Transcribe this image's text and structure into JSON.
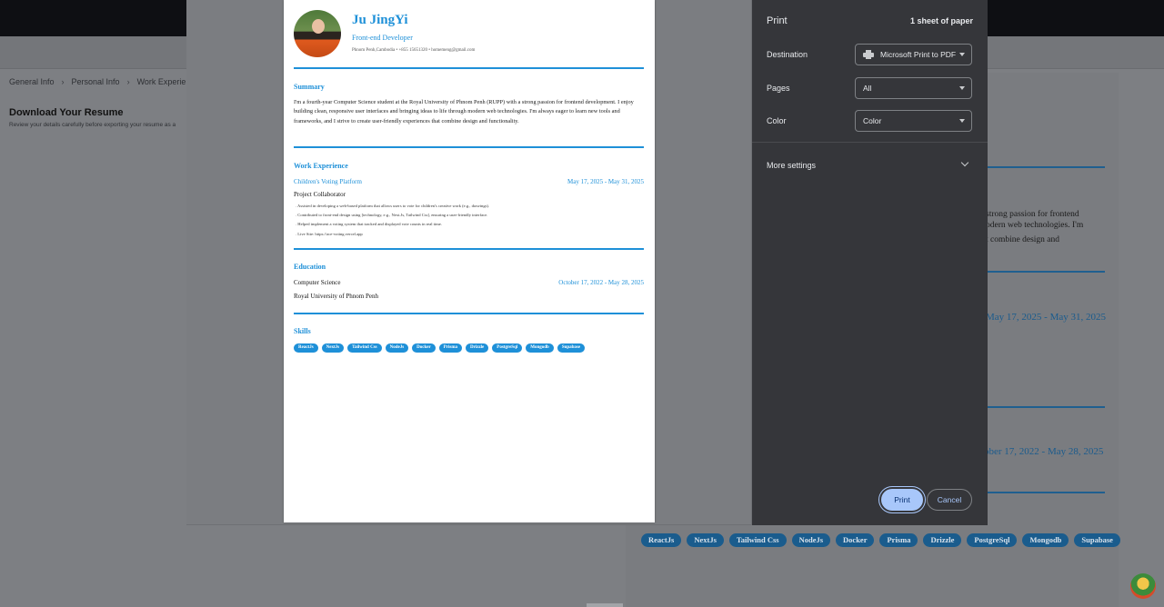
{
  "background_app": {
    "breadcrumbs": [
      "General Info",
      "Personal Info",
      "Work Experience"
    ],
    "page_title": "Download Your Resume",
    "page_subtitle": "Review your details carefully before exporting your resume as a",
    "preview_fragments": {
      "summary_line1": "strong passion for frontend",
      "summary_line2": "odern web technologies. I'm",
      "summary_line3": "t combine design and",
      "work_date": "May 17, 2025 - May 31, 2025",
      "edu_date": "ober 17, 2022 - May 28, 2025"
    },
    "skills": [
      "ReactJs",
      "NextJs",
      "Tailwind Css",
      "NodeJs",
      "Docker",
      "Prisma",
      "Drizzle",
      "PostgreSql",
      "Mongodb",
      "Supabase"
    ]
  },
  "resume": {
    "name": "Ju JingYi",
    "role": "Front-end Developer",
    "contact": "Phnom Penh,Cambodia • +855 15651320 • homemeng@gmail.com",
    "summary_heading": "Summary",
    "summary_text": "I'm a fourth-year Computer Science student at the Royal University of Phnom Penh (RUPP) with a strong passion for frontend development. I enjoy building clean, responsive user interfaces and bringing ideas to life through modern web technologies. I'm always eager to learn new tools and frameworks, and I strive to create user-friendly experiences that combine design and functionality.",
    "work_heading": "Work Experience",
    "work": {
      "title": "Children's Voting Platform",
      "dates": "May 17, 2025 - May 31, 2025",
      "position": "Project Collaborator",
      "bullets": [
        ". Assisted in developing a web-based platform that allows users to vote for children's creative work (e.g., drawings).",
        ". Contributed to front-end design using [technology, e.g., Next.Js, Tailwind Css], ensuring a user-friendly interface.",
        ". Helped implement a voting system that tracked and displayed vote counts in real time.",
        ". Live Site: https://ace-voting.vercel.app"
      ]
    },
    "education_heading": "Education",
    "education": {
      "degree": "Computer Science",
      "dates": "October 17, 2022 - May 28, 2025",
      "school": "Royal University of Phnom Penh"
    },
    "skills_heading": "Skills",
    "skills": [
      "ReactJs",
      "NextJs",
      "Tailwind Css",
      "NodeJs",
      "Docker",
      "Prisma",
      "Drizzle",
      "PostgreSql",
      "Mongodb",
      "Supabase"
    ]
  },
  "print_dialog": {
    "title": "Print",
    "sheets": "1 sheet of paper",
    "destination_label": "Destination",
    "destination_value": "Microsoft Print to PDF",
    "pages_label": "Pages",
    "pages_value": "All",
    "color_label": "Color",
    "color_value": "Color",
    "more_settings": "More settings",
    "print_button": "Print",
    "cancel_button": "Cancel"
  }
}
